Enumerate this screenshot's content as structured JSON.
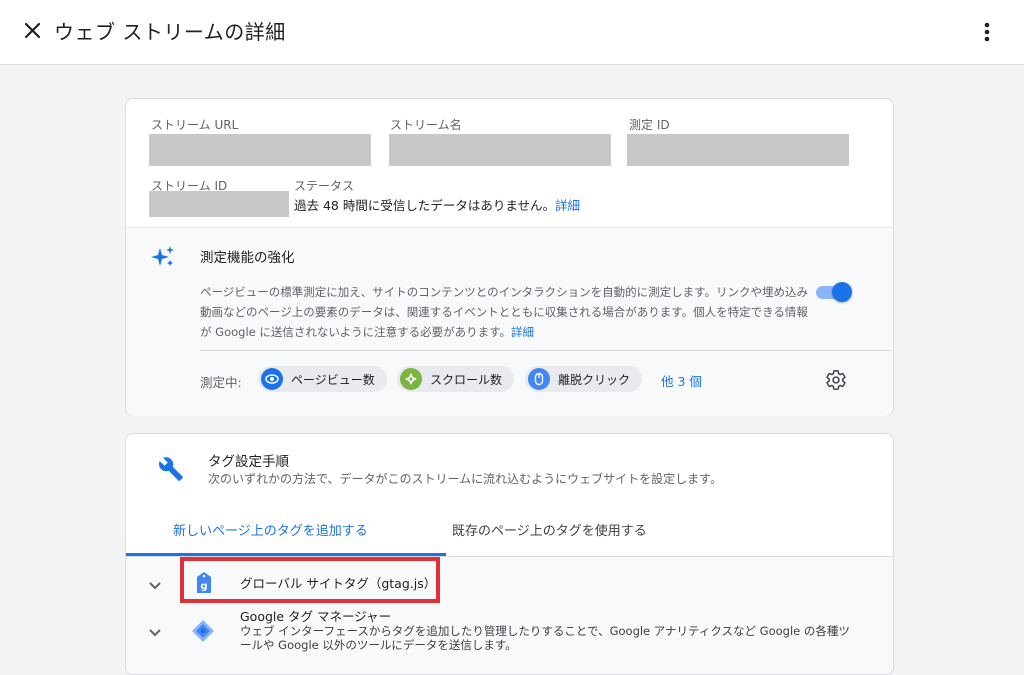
{
  "header": {
    "title": "ウェブ ストリームの詳細",
    "close_icon": "close-icon",
    "more_icon": "more-vert-icon"
  },
  "stream": {
    "url_label": "ストリーム URL",
    "name_label": "ストリーム名",
    "measurement_id_label": "測定 ID",
    "stream_id_label": "ストリーム ID",
    "status_label": "ステータス",
    "status_text": "過去 48 時間に受信したデータはありません。",
    "status_link": "詳細"
  },
  "enhanced": {
    "icon": "sparkle-icon",
    "title": "測定機能の強化",
    "description": "ページビューの標準測定に加え、サイトのコンテンツとのインタラクションを自動的に測定します。リンクや埋め込み動画などのページ上の要素のデータは、関連するイベントとともに収集される場合があります。個人を特定できる情報が Google に送信されないように注意する必要があります。",
    "description_link": "詳細",
    "toggle_on": true,
    "measuring_label": "測定中:",
    "chips": [
      {
        "label": "ページビュー数",
        "icon": "eye-icon",
        "color": "#1a73e8"
      },
      {
        "label": "スクロール数",
        "icon": "compass-icon",
        "color": "#7cb342"
      },
      {
        "label": "離脱クリック",
        "icon": "mouse-icon",
        "color": "#4285f4"
      }
    ],
    "more_link": "他 3 個",
    "settings_icon": "gear-icon"
  },
  "tagging": {
    "icon": "wrench-icon",
    "title": "タグ設定手順",
    "description": "次のいずれかの方法で、データがこのストリームに流れ込むようにウェブサイトを設定します。",
    "tabs": [
      {
        "label": "新しいページ上のタグを追加する",
        "active": true
      },
      {
        "label": "既存のページ上のタグを使用する",
        "active": false
      }
    ],
    "rows": [
      {
        "title": "グローバル サイトタグ（gtag.js）",
        "icon": "gtag-icon"
      },
      {
        "title": "Google タグ マネージャー",
        "icon": "gtm-icon",
        "description": "ウェブ インターフェースからタグを追加したり管理したりすることで、Google アナリティクスなど Google の各種ツールや Google 以外のツールにデータを送信します。"
      }
    ]
  },
  "colors": {
    "accent": "#1a73e8",
    "highlight": "#e0303a"
  }
}
